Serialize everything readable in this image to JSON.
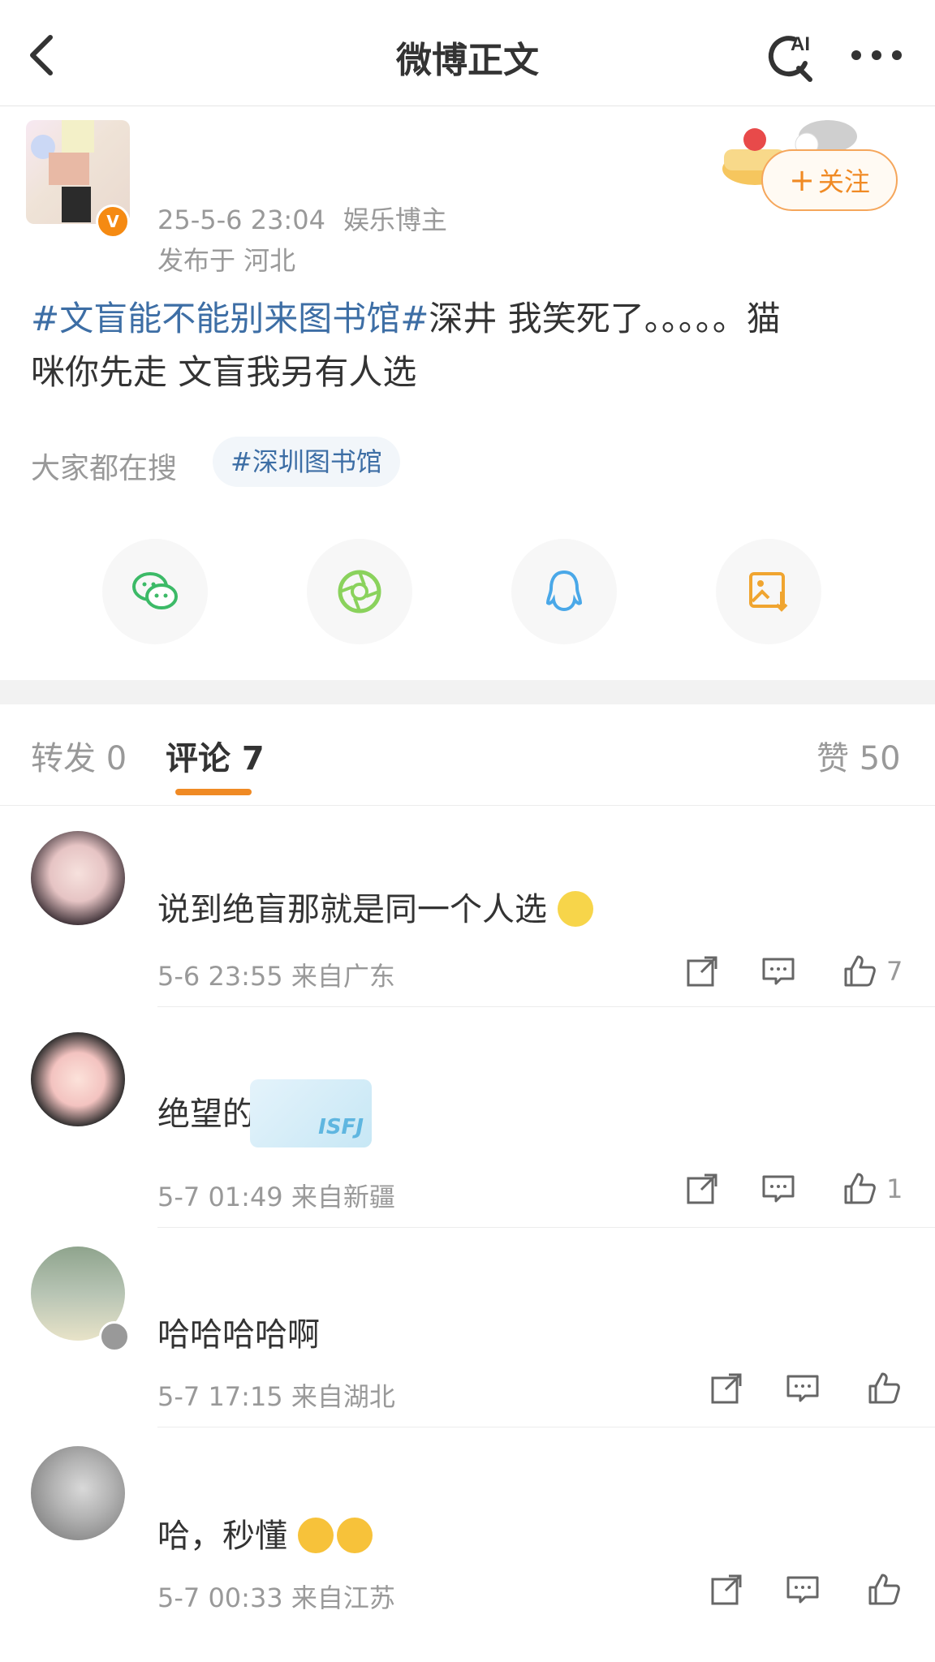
{
  "nav": {
    "title": "微博正文",
    "ai_label": "AI"
  },
  "post": {
    "datetime": "25-5-6 23:04",
    "source": "娱乐博主",
    "location": "发布于 河北",
    "follow_label": "关注",
    "verified_badge": "V",
    "hashtag": "#文盲能不能别来图书馆#",
    "text_line1_rest": "深井 我笑死了。。。。。猫",
    "text_line2": "咪你先走 文盲我另有人选",
    "trending_label": "大家都在搜",
    "trending_tag": "#深圳图书馆",
    "share_buttons": [
      "wechat-icon",
      "moments-icon",
      "qq-icon",
      "save-image-icon"
    ]
  },
  "tabs": {
    "repost": "转发 0",
    "comments": "评论 7",
    "likes": "赞 50"
  },
  "comments": [
    {
      "text": "说到绝盲那就是同一个人选",
      "emoji": "duck-emoji",
      "time": "5-6 23:55",
      "location": "来自广东",
      "likes": "7"
    },
    {
      "text": "绝望的?",
      "sticker": "ISFJ",
      "time": "5-7 01:49",
      "location": "来自新疆",
      "likes": "1"
    },
    {
      "text": "哈哈哈哈啊",
      "time": "5-7 17:15",
      "location": "来自湖北",
      "likes": ""
    },
    {
      "text": "哈，秒懂",
      "emoji": "laugh-cry-emoji",
      "time": "5-7 00:33",
      "location": "来自江苏",
      "likes": ""
    }
  ],
  "colors": {
    "accent": "#f08a24",
    "link": "#3d6ea5",
    "meta": "#999999",
    "wechat": "#3cba67",
    "moments": "#8ad25c",
    "qq": "#4aa8e8",
    "save": "#f0a530"
  }
}
